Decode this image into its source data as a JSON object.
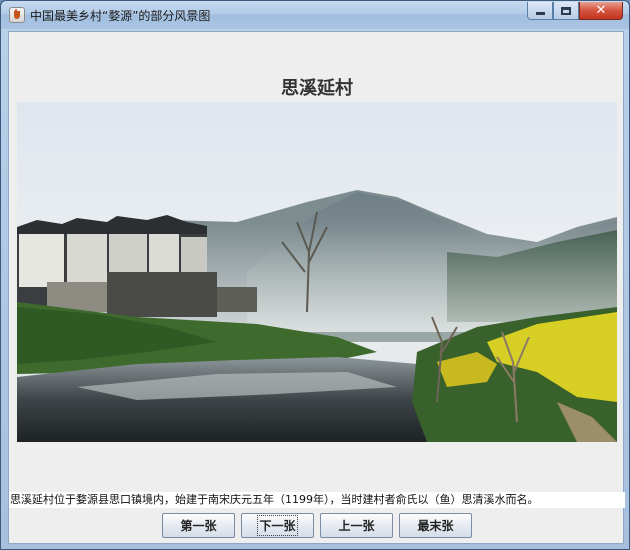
{
  "window": {
    "title": "中国最美乡村“婺源”的部分风景图"
  },
  "main": {
    "heading": "思溪延村",
    "image_alt": "思溪延村风景图",
    "caption": "思溪延村位于婺源县思口镇境内，始建于南宋庆元五年（1199年），当时建村者俞氏以（鱼）思清溪水而名。"
  },
  "buttons": {
    "first": "第一张",
    "next": "下一张",
    "prev": "上一张",
    "last": "最末张"
  }
}
